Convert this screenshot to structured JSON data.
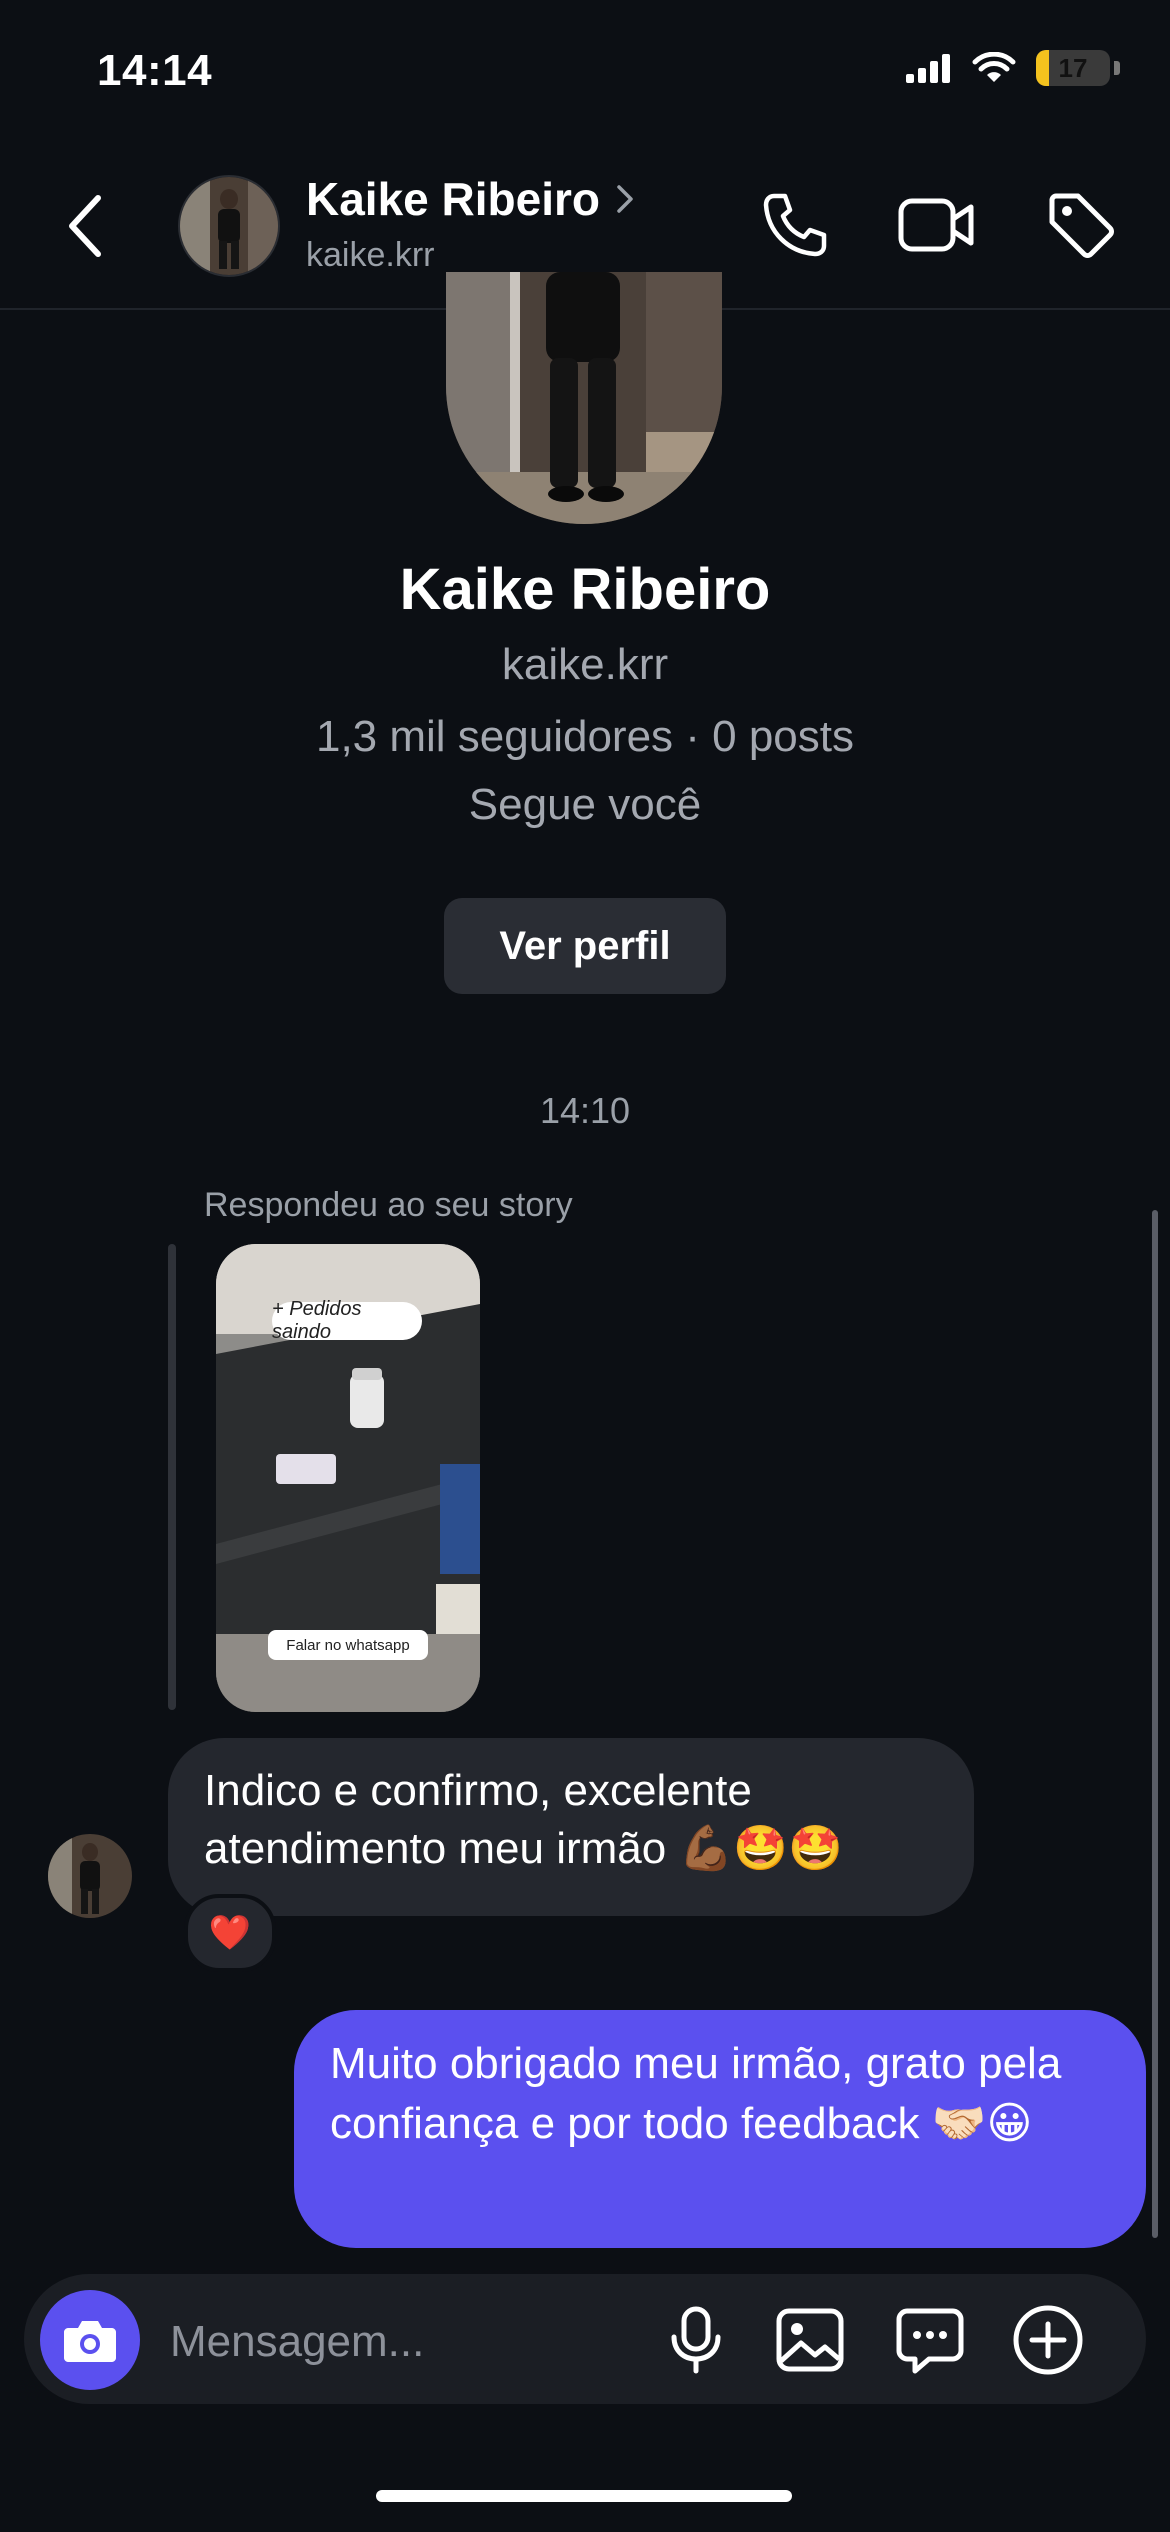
{
  "status_bar": {
    "time": "14:14",
    "battery": "17",
    "battery_level": 0.17
  },
  "header": {
    "name": "Kaike Ribeiro",
    "username": "kaike.krr"
  },
  "profile": {
    "name": "Kaike Ribeiro",
    "username": "kaike.krr",
    "stats": "1,3 mil seguidores · 0 posts",
    "follows_you": "Segue você",
    "view_profile_label": "Ver perfil"
  },
  "conversation": {
    "time_separator": "14:10",
    "story_reply_label": "Respondeu ao seu story",
    "story_tag_top": "+ Pedidos saindo",
    "story_tag_bottom": "Falar no whatsapp",
    "incoming_message": "Indico e confirmo, excelente atendimento meu irmão 💪🏾🤩🤩",
    "reaction": "❤️",
    "outgoing_message": "Muito obrigado meu irmão, grato pela confiança e por todo feedback 🤝🏻😀"
  },
  "composer": {
    "placeholder": "Mensagem..."
  },
  "colors": {
    "accent": "#5b50ef",
    "background": "#0c0f14",
    "incoming_bubble": "#24272e"
  },
  "icons": [
    "back-chevron-icon",
    "chevron-right-icon",
    "phone-icon",
    "video-icon",
    "tag-icon",
    "camera-icon",
    "microphone-icon",
    "gallery-icon",
    "chat-sticker-icon",
    "plus-circle-icon"
  ]
}
